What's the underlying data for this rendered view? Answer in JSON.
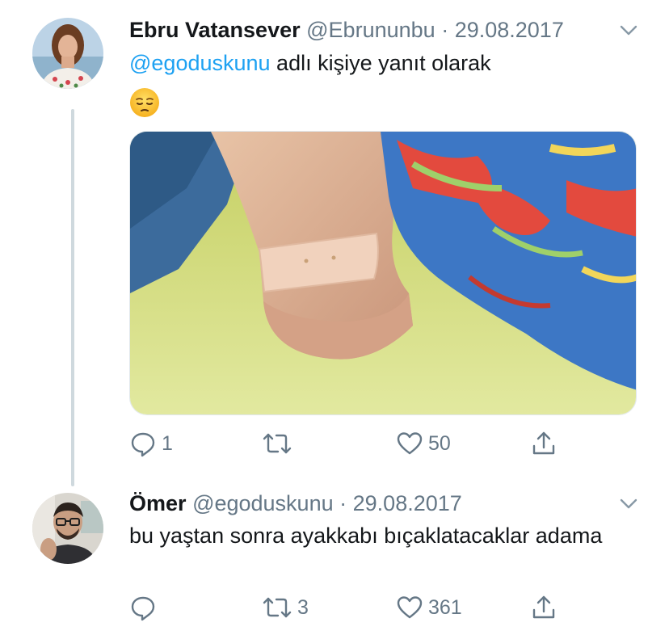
{
  "tweets": [
    {
      "author_name": "Ebru Vatansever",
      "handle": "@Ebrununbu",
      "separator": "·",
      "date": "29.08.2017",
      "reply_mention": "@egoduskunu",
      "reply_suffix": " adlı kişiye yanıt olarak",
      "emoji_icon": "pensive-face-emoji",
      "has_media": true,
      "reply_count": "1",
      "retweet_count": "",
      "like_count": "50"
    },
    {
      "author_name": "Ömer",
      "handle": "@egoduskunu",
      "separator": "·",
      "date": "29.08.2017",
      "text": "bu yaştan sonra ayakkabı bıçaklatacaklar adama",
      "reply_count": "",
      "retweet_count": "3",
      "like_count": "361"
    }
  ],
  "icons": {
    "reply": "reply-icon",
    "retweet": "retweet-icon",
    "like": "heart-icon",
    "share": "share-icon",
    "more": "chevron-down-icon"
  },
  "colors": {
    "text": "#14171a",
    "secondary": "#657786",
    "link": "#1da1f2",
    "thread_line": "#cfd9de"
  }
}
